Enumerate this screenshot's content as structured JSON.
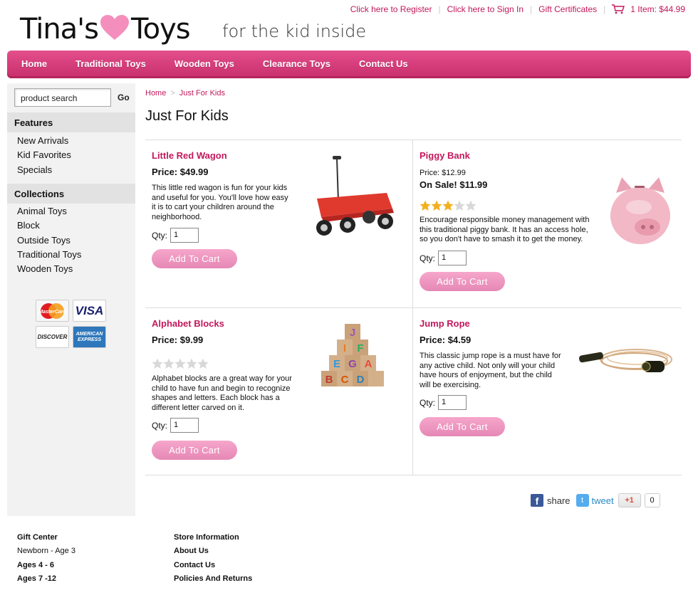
{
  "brand": {
    "logo_left": "Tina's",
    "logo_right": "Toys",
    "tagline": "for the kid inside",
    "accent": "#c2185b",
    "nav_color": "#d43c7a"
  },
  "util": {
    "register": "Click here to Register",
    "signin": "Click here to Sign In",
    "gift": "Gift Certificates",
    "cart": "1 Item: $44.99"
  },
  "nav": [
    "Home",
    "Traditional Toys",
    "Wooden Toys",
    "Clearance Toys",
    "Contact Us"
  ],
  "sidebar": {
    "search_placeholder": "product search",
    "go": "Go",
    "features_title": "Features",
    "features": [
      "New Arrivals",
      "Kid Favorites",
      "Specials"
    ],
    "collections_title": "Collections",
    "collections": [
      "Animal Toys",
      "Block",
      "Outside Toys",
      "Traditional Toys",
      "Wooden Toys"
    ],
    "cards": [
      "MasterCard",
      "VISA",
      "DISCOVER",
      "AMERICAN EXPRESS"
    ]
  },
  "breadcrumb": {
    "home": "Home",
    "current": "Just For Kids"
  },
  "page_title": "Just For Kids",
  "products": [
    {
      "name": "Little Red Wagon",
      "price": "Price: $49.99",
      "desc": "This little red wagon is fun for your kids and useful for you. You'll love how easy it is to cart your children around the neighborhood.",
      "qty_label": "Qty:",
      "qty": "1",
      "button": "Add To Cart"
    },
    {
      "name": "Piggy Bank",
      "old_price": "Price: $12.99",
      "sale_price": "On Sale! $11.99",
      "rating": 3,
      "rating_max": 5,
      "desc": "Encourage responsible money management with this traditional piggy bank. It has an access hole, so you don't have to smash it to get the money.",
      "qty_label": "Qty:",
      "qty": "1",
      "button": "Add To Cart"
    },
    {
      "name": "Alphabet Blocks",
      "price": "Price: $9.99",
      "rating": 0,
      "rating_max": 5,
      "desc": "Alphabet blocks are a great way for your child to have fun and begin to recognize shapes and letters. Each block has a different letter carved on it.",
      "qty_label": "Qty:",
      "qty": "1",
      "button": "Add To Cart",
      "block_letters": [
        "J",
        "I",
        "F",
        "E",
        "G",
        "A",
        "B",
        "C",
        "D"
      ]
    },
    {
      "name": "Jump Rope",
      "price": "Price: $4.59",
      "desc": "This classic jump rope is a must have for any active child. Not only will your child have hours of enjoyment, but the child will be exercising.",
      "qty_label": "Qty:",
      "qty": "1",
      "button": "Add To Cart"
    }
  ],
  "social": {
    "share": "share",
    "tweet": "tweet",
    "gplus": "+1",
    "gplus_count": "0"
  },
  "footer": {
    "col1": [
      "Gift Center",
      "Newborn - Age 3",
      "Ages 4 - 6",
      "Ages 7 -12"
    ],
    "col2": [
      "Store Information",
      "About Us",
      "Contact Us",
      "Policies And Returns"
    ]
  }
}
